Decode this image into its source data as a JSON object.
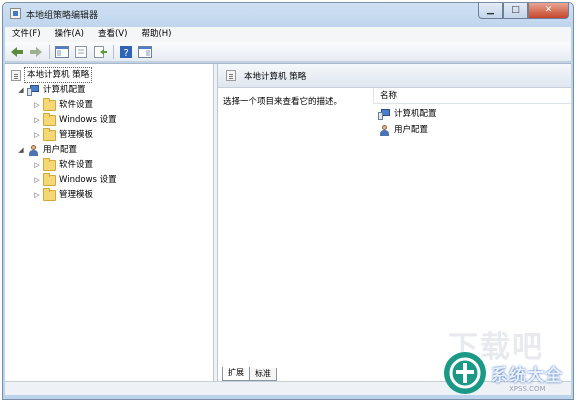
{
  "window": {
    "title": "本地组策略编辑器",
    "min": "▁",
    "max": "□",
    "close": "✕"
  },
  "menu": [
    "文件(F)",
    "操作(A)",
    "查看(V)",
    "帮助(H)"
  ],
  "tree": {
    "root": "本地计算机 策略",
    "computer": {
      "label": "计算机配置",
      "children": [
        "软件设置",
        "Windows 设置",
        "管理模板"
      ]
    },
    "user": {
      "label": "用户配置",
      "children": [
        "软件设置",
        "Windows 设置",
        "管理模板"
      ]
    }
  },
  "right": {
    "header": "本地计算机 策略",
    "description": "选择一个项目来查看它的描述。",
    "column_name": "名称",
    "items": [
      "计算机配置",
      "用户配置"
    ]
  },
  "tabs": [
    "扩展",
    "标准"
  ],
  "watermark": {
    "big": "下载吧",
    "text": "系统大全",
    "site": "XPSS.COM"
  }
}
